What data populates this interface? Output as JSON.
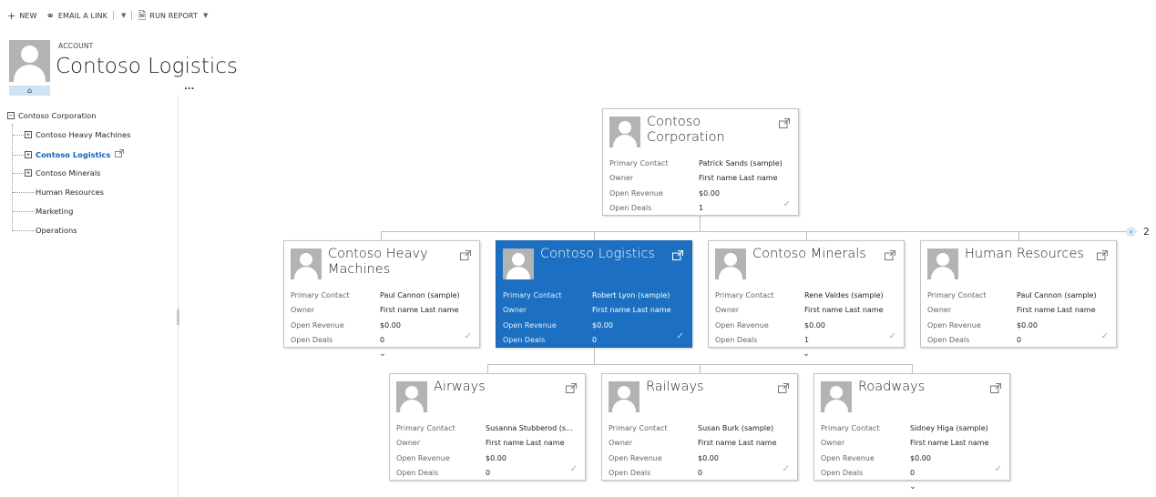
{
  "command_bar": {
    "new_label": "NEW",
    "email_label": "EMAIL A LINK",
    "run_report_label": "RUN REPORT"
  },
  "header": {
    "entity": "ACCOUNT",
    "title": "Contoso Logistics",
    "more": "..."
  },
  "tree": {
    "root": "Contoso Corporation",
    "items": [
      {
        "label": "Contoso Heavy Machines",
        "expandable": true
      },
      {
        "label": "Contoso Logistics",
        "expandable": true,
        "selected": true
      },
      {
        "label": "Contoso Minerals",
        "expandable": true
      },
      {
        "label": "Human Resources",
        "expandable": false
      },
      {
        "label": "Marketing",
        "expandable": false
      },
      {
        "label": "Operations",
        "expandable": false
      }
    ]
  },
  "field_labels": {
    "primary_contact": "Primary Contact",
    "owner": "Owner",
    "open_revenue": "Open Revenue",
    "open_deals": "Open Deals"
  },
  "cards": {
    "root": {
      "name": "Contoso Corporation",
      "primary_contact": "Patrick Sands (sample)",
      "owner": "First name Last name",
      "open_revenue": "$0.00",
      "open_deals": "1"
    },
    "heavy": {
      "name": "Contoso Heavy Machines",
      "primary_contact": "Paul Cannon (sample)",
      "owner": "First name Last name",
      "open_revenue": "$0.00",
      "open_deals": "0"
    },
    "logistics": {
      "name": "Contoso Logistics",
      "primary_contact": "Robert Lyon (sample)",
      "owner": "First name Last name",
      "open_revenue": "$0.00",
      "open_deals": "0"
    },
    "minerals": {
      "name": "Contoso Minerals",
      "primary_contact": "Rene Valdes (sample)",
      "owner": "First name Last name",
      "open_revenue": "$0.00",
      "open_deals": "1"
    },
    "hr": {
      "name": "Human Resources",
      "primary_contact": "Paul Cannon (sample)",
      "owner": "First name Last name",
      "open_revenue": "$0.00",
      "open_deals": "0"
    },
    "airways": {
      "name": "Airways",
      "primary_contact": "Susanna Stubberod (s...",
      "owner": "First name Last name",
      "open_revenue": "$0.00",
      "open_deals": "0"
    },
    "railways": {
      "name": "Railways",
      "primary_contact": "Susan Burk (sample)",
      "owner": "First name Last name",
      "open_revenue": "$0.00",
      "open_deals": "0"
    },
    "roadways": {
      "name": "Roadways",
      "primary_contact": "Sidney Higa (sample)",
      "owner": "First name Last name",
      "open_revenue": "$0.00",
      "open_deals": "0"
    }
  },
  "pager": {
    "page": "2"
  },
  "colors": {
    "accent": "#1d6fc1",
    "selected_tree": "#1160b7"
  }
}
